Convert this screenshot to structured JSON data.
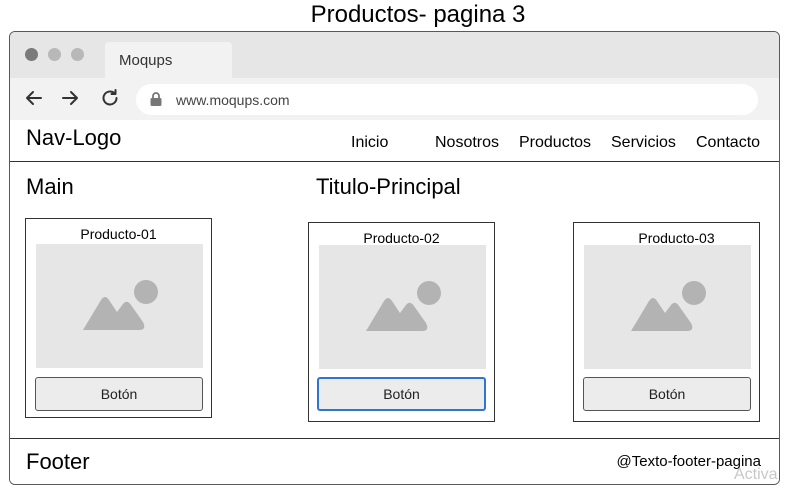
{
  "page_title": "Productos- pagina 3",
  "browser": {
    "tab_label": "Moqups",
    "url": "www.moqups.com",
    "icons": [
      "back-arrow-icon",
      "forward-arrow-icon",
      "reload-icon",
      "lock-icon"
    ]
  },
  "nav": {
    "logo": "Nav-Logo",
    "links": [
      "Inicio",
      "Nosotros",
      "Productos",
      "Servicios",
      "Contacto"
    ]
  },
  "main": {
    "label": "Main",
    "title": "Titulo-Principal"
  },
  "products": [
    {
      "title": "Producto-01",
      "button": "Botón",
      "focused": false
    },
    {
      "title": "Producto-02",
      "button": "Botón",
      "focused": true
    },
    {
      "title": "Producto-03",
      "button": "Botón",
      "focused": false
    }
  ],
  "footer": {
    "label": "Footer",
    "text": "@Texto-footer-pagina"
  },
  "watermark": "Activa",
  "colors": {
    "focus_border": "#2f76d1",
    "placeholder_bg": "#e6e6e6",
    "placeholder_icon": "#b3b3b3"
  }
}
